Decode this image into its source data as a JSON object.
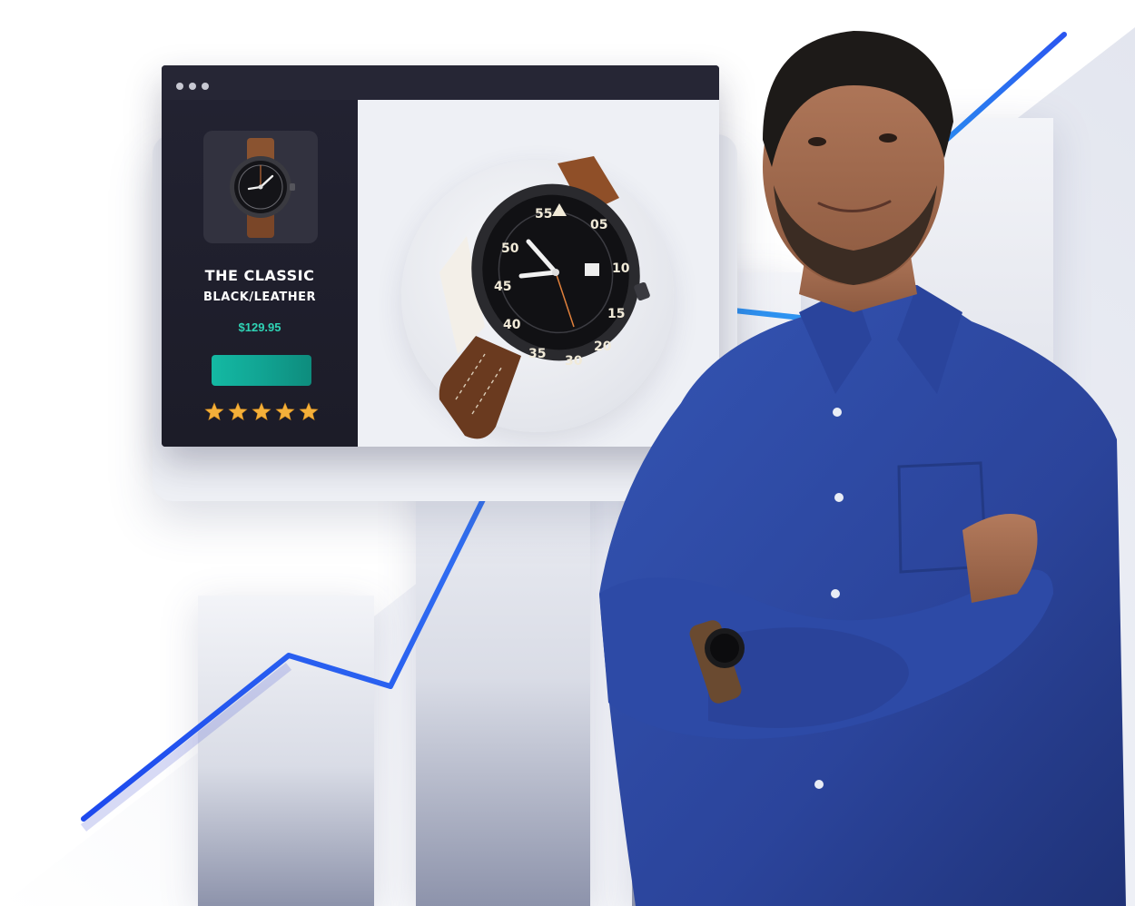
{
  "product": {
    "name": "THE CLASSIC",
    "variant": "BLACK/LEATHER",
    "price": "$129.95",
    "rating": 5,
    "rating_max": 5
  },
  "colors": {
    "accent": "#14b9a3",
    "price": "#2fd3b5",
    "star": "#f4b03a",
    "trend_line": "#2f6df0",
    "shirt": "#2f4ba6",
    "window_dark": "#232330"
  },
  "icons": [
    "window-dot-icon",
    "star-icon",
    "watch-image"
  ]
}
